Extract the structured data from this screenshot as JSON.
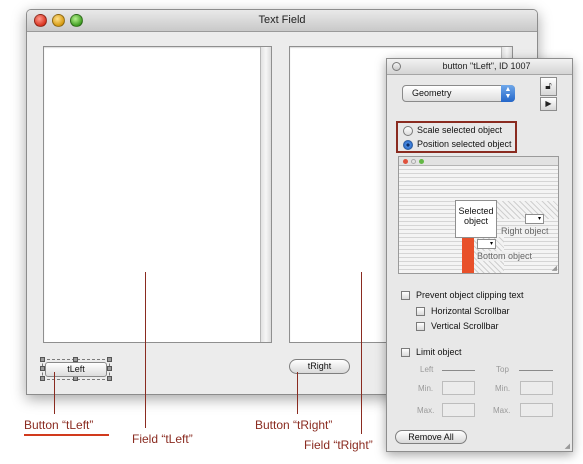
{
  "main_window": {
    "title": "Text Field",
    "button_left_label": "tLeft",
    "button_right_label": "tRight"
  },
  "annotations": {
    "button_tleft": "Button “tLeft”",
    "field_tleft": "Field “tLeft”",
    "button_tright": "Button “tRight”",
    "field_tright": "Field “tRight”"
  },
  "inspector": {
    "title": "button \"tLeft\", ID 1007",
    "section_popup": "Geometry",
    "radio_scale": "Scale selected object",
    "radio_position": "Position selected object",
    "radio_selected": "Position selected object",
    "preview": {
      "selected_label": "Selected object",
      "right_label": "Right object",
      "bottom_label": "Bottom object"
    },
    "prevent_clipping": "Prevent object clipping text",
    "horizontal_scrollbar": "Horizontal Scrollbar",
    "vertical_scrollbar": "Vertical Scrollbar",
    "limit_object": "Limit object",
    "left_label": "Left",
    "top_label": "Top",
    "min_label": "Min.",
    "max_label": "Max.",
    "remove_all": "Remove All"
  },
  "colors": {
    "annotation": "#8a2b20",
    "accent_bar": "#e8502a",
    "popup_accent": "#2466c9"
  },
  "icons": {
    "lock": "lock-icon",
    "play": "play-icon"
  }
}
